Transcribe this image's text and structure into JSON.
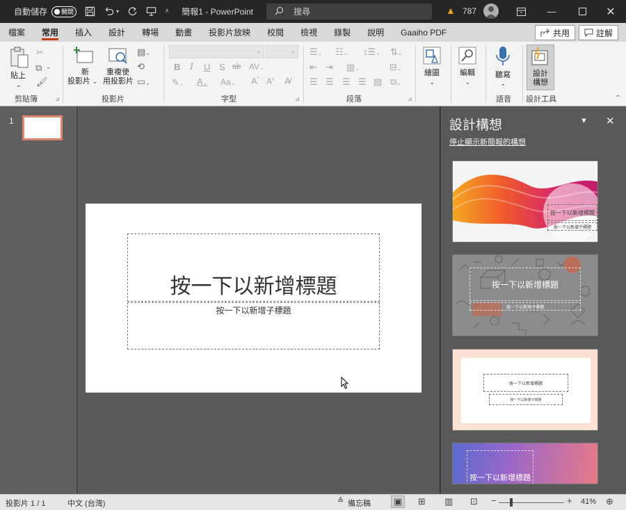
{
  "titlebar": {
    "autosave_label": "自動儲存",
    "autosave_toggle": "關閉",
    "doc_title": "簡報1 - PowerPoint",
    "search_placeholder": "搜尋",
    "warning_count": "787"
  },
  "tabs": [
    "檔案",
    "常用",
    "插入",
    "設計",
    "轉場",
    "動畫",
    "投影片放映",
    "校閱",
    "檢視",
    "錄製",
    "說明",
    "Gaaiho PDF"
  ],
  "active_tab": "常用",
  "actions": {
    "share": "共用",
    "comments": "註解"
  },
  "ribbon": {
    "clipboard": {
      "paste": "貼上",
      "group": "剪貼簿"
    },
    "slides": {
      "new_slide_1": "新",
      "new_slide_2": "投影片",
      "reuse_1": "重複使",
      "reuse_2": "用投影片",
      "group": "投影片"
    },
    "font": {
      "group": "字型",
      "bold": "B",
      "italic": "I",
      "underline": "U",
      "shadow": "S",
      "strike": "ab",
      "spacing": "AV",
      "case": "Aa",
      "grow": "A",
      "shrink": "A"
    },
    "paragraph": {
      "group": "段落"
    },
    "drawing": {
      "label": "繪圖"
    },
    "editing": {
      "label": "編輯"
    },
    "voice": {
      "dictate": "聽寫",
      "group": "語音"
    },
    "designer": {
      "label_1": "設計",
      "label_2": "構想",
      "group": "設計工具"
    }
  },
  "thumbnails": {
    "slide_number": "1"
  },
  "slide": {
    "title_placeholder": "按一下以新增標題",
    "subtitle_placeholder": "按一下以新增子標題"
  },
  "designer_pane": {
    "title": "設計構想",
    "stop_link": "停止顯示新簡報的構想",
    "design1_title": "按一下以新增標題",
    "design1_sub": "按一下以新增子標題",
    "design2_title": "按一下以新增標題",
    "design2_sub": "按一下以新增子標題",
    "design3_title": "按一下以新增標題",
    "design3_sub": "按一下以新增子標題",
    "design4_title": "按一下以新增標題"
  },
  "statusbar": {
    "slide_info": "投影片 1 / 1",
    "language": "中文 (台灣)",
    "notes": "備忘稿",
    "zoom": "41%"
  },
  "colors": {
    "accent": "#c43e1c",
    "thumb_selected": "#e0866e",
    "warning": "#f0a020"
  }
}
